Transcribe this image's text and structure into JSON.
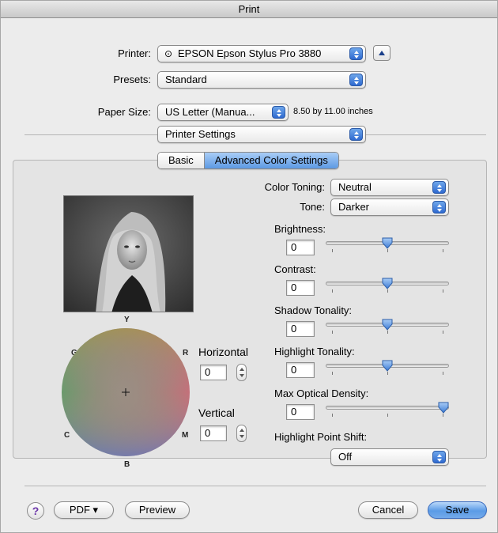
{
  "window": {
    "title": "Print"
  },
  "printer": {
    "label": "Printer:",
    "value": "EPSON Epson Stylus Pro 3880",
    "icon": "network-printer-icon"
  },
  "presets": {
    "label": "Presets:",
    "value": "Standard"
  },
  "paper": {
    "label": "Paper Size:",
    "value": "US Letter (Manua...",
    "dimensions": "8.50 by 11.00 inches"
  },
  "section": {
    "value": "Printer Settings"
  },
  "tabs": [
    {
      "label": "Basic",
      "selected": false
    },
    {
      "label": "Advanced Color Settings",
      "selected": true
    }
  ],
  "color_toning": {
    "label": "Color Toning:",
    "value": "Neutral"
  },
  "tone": {
    "label": "Tone:",
    "value": "Darker"
  },
  "sliders": [
    {
      "label": "Brightness:",
      "value": "0",
      "level": 0.5
    },
    {
      "label": "Contrast:",
      "value": "0",
      "level": 0.5
    },
    {
      "label": "Shadow Tonality:",
      "value": "0",
      "level": 0.5
    },
    {
      "label": "Highlight Tonality:",
      "value": "0",
      "level": 0.5
    },
    {
      "label": "Max Optical Density:",
      "value": "0",
      "level": 1.0
    }
  ],
  "highlight_point_shift": {
    "label": "Highlight Point Shift:",
    "value": "Off"
  },
  "color_wheel": {
    "top": "Y",
    "left_upper": "G",
    "right_upper": "R",
    "left_lower": "C",
    "right_lower": "M",
    "bottom": "B"
  },
  "horizontal": {
    "label": "Horizontal",
    "value": "0"
  },
  "vertical": {
    "label": "Vertical",
    "value": "0"
  },
  "footer": {
    "help": "?",
    "pdf": "PDF ▾",
    "preview": "Preview",
    "cancel": "Cancel",
    "save": "Save"
  },
  "colors": {
    "accent": "#5b9be6",
    "window_bg": "#ececec",
    "help_glyph": "#6b35a8"
  }
}
